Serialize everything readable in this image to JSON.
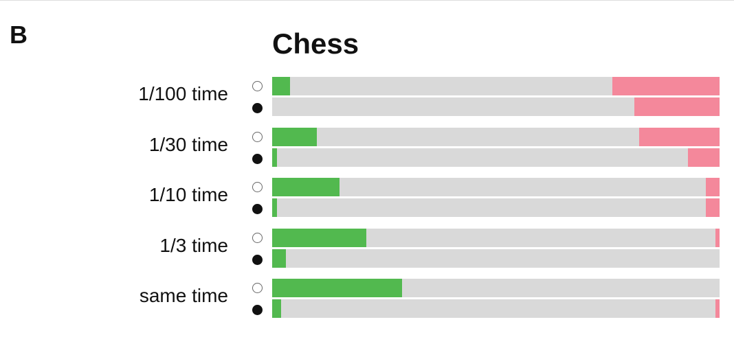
{
  "panel_label": "B",
  "chart_data": {
    "type": "bar",
    "title": "Chess",
    "orientation": "horizontal-stacked",
    "categories": [
      "1/100 time",
      "1/30 time",
      "1/10 time",
      "1/3 time",
      "same time"
    ],
    "series_markers": [
      "open-circle",
      "filled-circle"
    ],
    "colors": {
      "green": "#52b94f",
      "gray": "#d9d9d9",
      "pink": "#f4889b"
    },
    "units": "percent",
    "rows": [
      {
        "category": "1/100 time",
        "open": {
          "green": 4,
          "pink": 24
        },
        "filled": {
          "green": 0,
          "pink": 19
        }
      },
      {
        "category": "1/30 time",
        "open": {
          "green": 10,
          "pink": 18
        },
        "filled": {
          "green": 1,
          "pink": 7
        }
      },
      {
        "category": "1/10 time",
        "open": {
          "green": 15,
          "pink": 3
        },
        "filled": {
          "green": 1,
          "pink": 3
        }
      },
      {
        "category": "1/3 time",
        "open": {
          "green": 21,
          "pink": 1
        },
        "filled": {
          "green": 3,
          "pink": 0
        }
      },
      {
        "category": "same time",
        "open": {
          "green": 29,
          "pink": 0
        },
        "filled": {
          "green": 2,
          "pink": 1
        }
      }
    ]
  }
}
